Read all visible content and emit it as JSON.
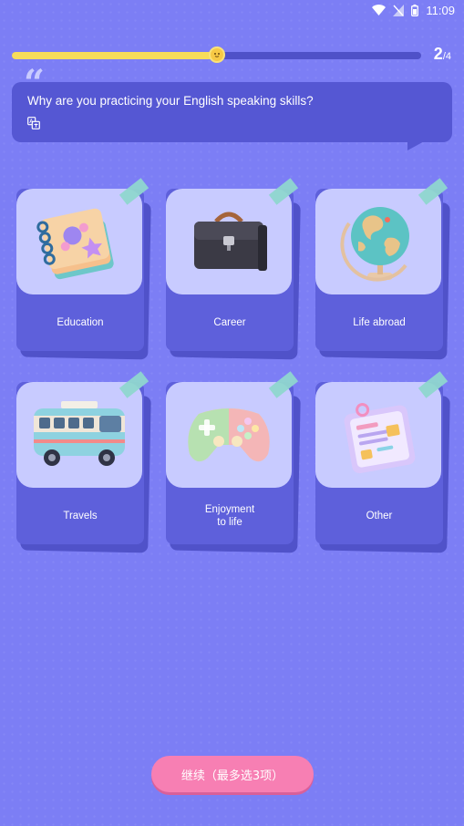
{
  "status_bar": {
    "time": "11:09",
    "icons": [
      "wifi-icon",
      "signal-muted-icon",
      "battery-icon"
    ]
  },
  "progress": {
    "current": "2",
    "total": "/4",
    "fraction": 0.5
  },
  "question": {
    "quote_mark": "“",
    "text": "Why are you practicing your English speaking skills?",
    "translate_icon": "translate-icon"
  },
  "options": [
    {
      "label": "Education",
      "icon": "notebook-icon"
    },
    {
      "label": "Career",
      "icon": "briefcase-icon"
    },
    {
      "label": "Life abroad",
      "icon": "globe-icon"
    },
    {
      "label": "Travels",
      "icon": "bus-icon"
    },
    {
      "label_line1": "Enjoyment",
      "label_line2": "to life",
      "icon": "gamepad-icon"
    },
    {
      "label": "Other",
      "icon": "clipboard-icon"
    }
  ],
  "continue_button": {
    "label": "继续（最多选3项）"
  },
  "colors": {
    "background": "#7c7ef5",
    "card": "#5e60db",
    "image_tile": "#c8cbff",
    "progress_fill": "#f7dd5a",
    "button": "#f77fb3"
  }
}
